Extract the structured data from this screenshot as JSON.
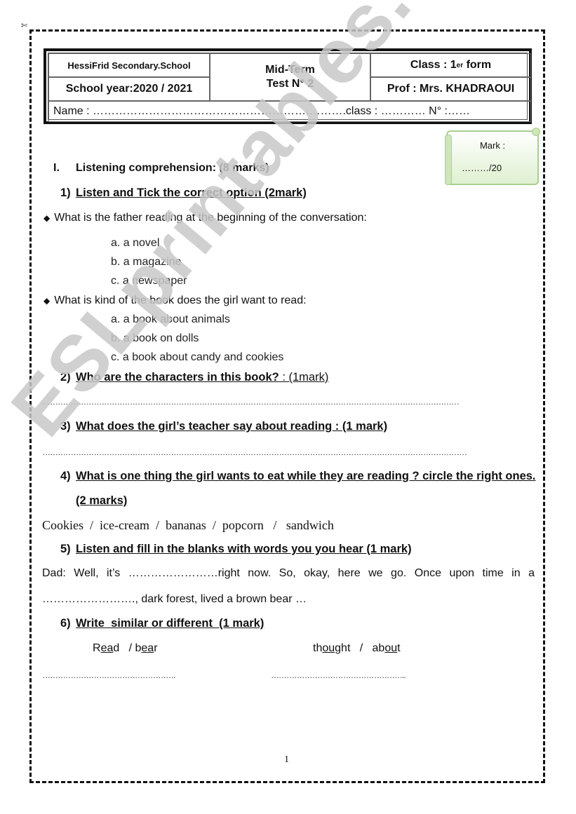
{
  "header": {
    "school": "HessiFrid Secondary.School",
    "school_year": "School year:2020 / 2021",
    "test_line1": "Mid-Term",
    "test_line2": "Test N° 2",
    "class_prefix": "Class : 1",
    "class_sup": "er",
    "class_suffix": " form",
    "prof": "Prof : Mrs. KHADRAOUI",
    "name_line": "Name : ………………………………………………….……….class : ………… N° :……"
  },
  "mark_box": {
    "label": "Mark :",
    "value": "………/20"
  },
  "section1": {
    "number": "I.",
    "title": "Listening comprehension: (8 marks)"
  },
  "questions": {
    "q1": {
      "number": "1)",
      "title": "Listen and Tick the correct option (2mark)",
      "items": [
        {
          "prompt": "What is the father reading at the beginning of the conversation:",
          "options": [
            "a. a novel",
            "b. a magazine",
            "c. a newspaper"
          ]
        },
        {
          "prompt": "What is kind of the book does the girl want to read:",
          "options": [
            "a. a book about animals",
            "b. a book on dolls",
            "c. a book about candy and cookies"
          ]
        }
      ]
    },
    "q2": {
      "number": "2)",
      "title": "Who are the characters in this book?",
      "marks": " : (1mark)",
      "answer_line": "………………………………………………………………………………………………………………………………………………"
    },
    "q3": {
      "number": "3)",
      "title": "What does the girl’s teacher say about reading : (1 mark)",
      "answer_line": "…………………………………………………………………………………………………………………………………………………"
    },
    "q4": {
      "number": "4)",
      "title": "What is one thing the girl wants to eat while they are reading ? circle the right ones.",
      "marks": "(2 marks)",
      "choices": "Cookies  /  ice-cream  /  bananas  /  popcorn   /   sandwich"
    },
    "q5": {
      "number": "5)",
      "title": "Listen and fill in the blanks with words you you hear (1 mark)",
      "line1": "Dad: Well, it’s ……………………right now. So, okay, here we go. Once upon time in a",
      "line2": "……………………., dark forest, lived a brown bear …"
    },
    "q6": {
      "number": "6)",
      "title": "Write  similar or different  (1 mark)",
      "pair1": {
        "w1_a": "R",
        "w1_u": "ea",
        "w1_b": "d",
        "sep": "   / ",
        "w2_a": "b",
        "w2_u": "ea",
        "w2_b": "r"
      },
      "pair2": {
        "w1_a": "th",
        "w1_u": "ou",
        "w1_b": "ght",
        "sep": "   /   ",
        "w2_a": "ab",
        "w2_u": "ou",
        "w2_b": "t"
      },
      "answer1": "…………………………………………….",
      "answer2": "…………………………………………….."
    }
  },
  "watermark": "ESLprintables.com",
  "page_number": "1"
}
